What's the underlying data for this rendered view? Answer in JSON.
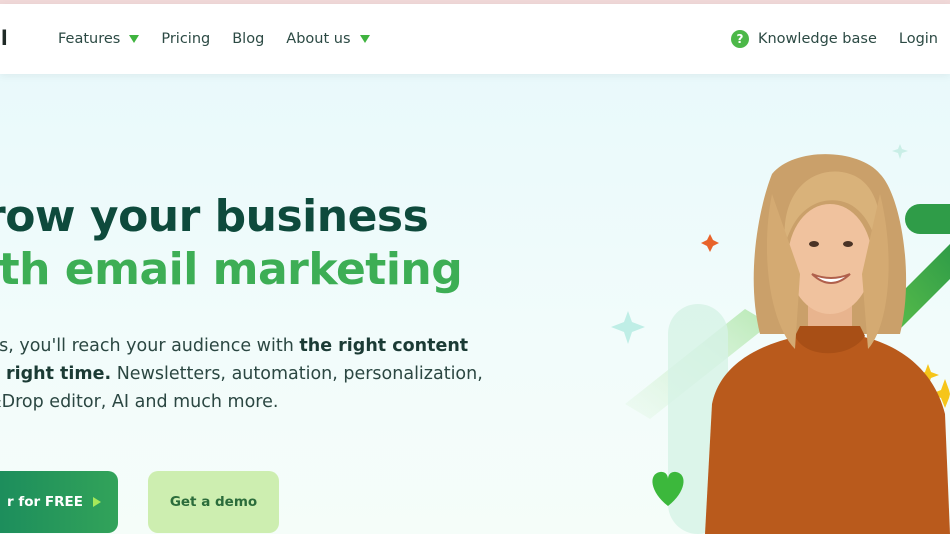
{
  "nav": {
    "logo_text": "il",
    "items": [
      {
        "label": "Features",
        "has_dropdown": true
      },
      {
        "label": "Pricing",
        "has_dropdown": false
      },
      {
        "label": "Blog",
        "has_dropdown": false
      },
      {
        "label": "About us",
        "has_dropdown": true
      }
    ],
    "knowledge_base": "Knowledge base",
    "knowledge_icon_glyph": "?",
    "login": "Login"
  },
  "hero": {
    "headline_line1": "row your business",
    "headline_line2": "ith email marketing",
    "para_part1": " us, you'll reach your audience with ",
    "para_bold1": "the right content",
    "para_part2": "e right time.",
    "para_part3": " Newsletters, automation, personalization,",
    "para_part4": "&Drop editor, AI and much more.",
    "cta_primary": "r for FREE",
    "cta_secondary": "Get a demo"
  },
  "colors": {
    "accent_green": "#3dae55",
    "dark_green": "#0e4a3c",
    "orange_sweater": "#b95a1c"
  }
}
